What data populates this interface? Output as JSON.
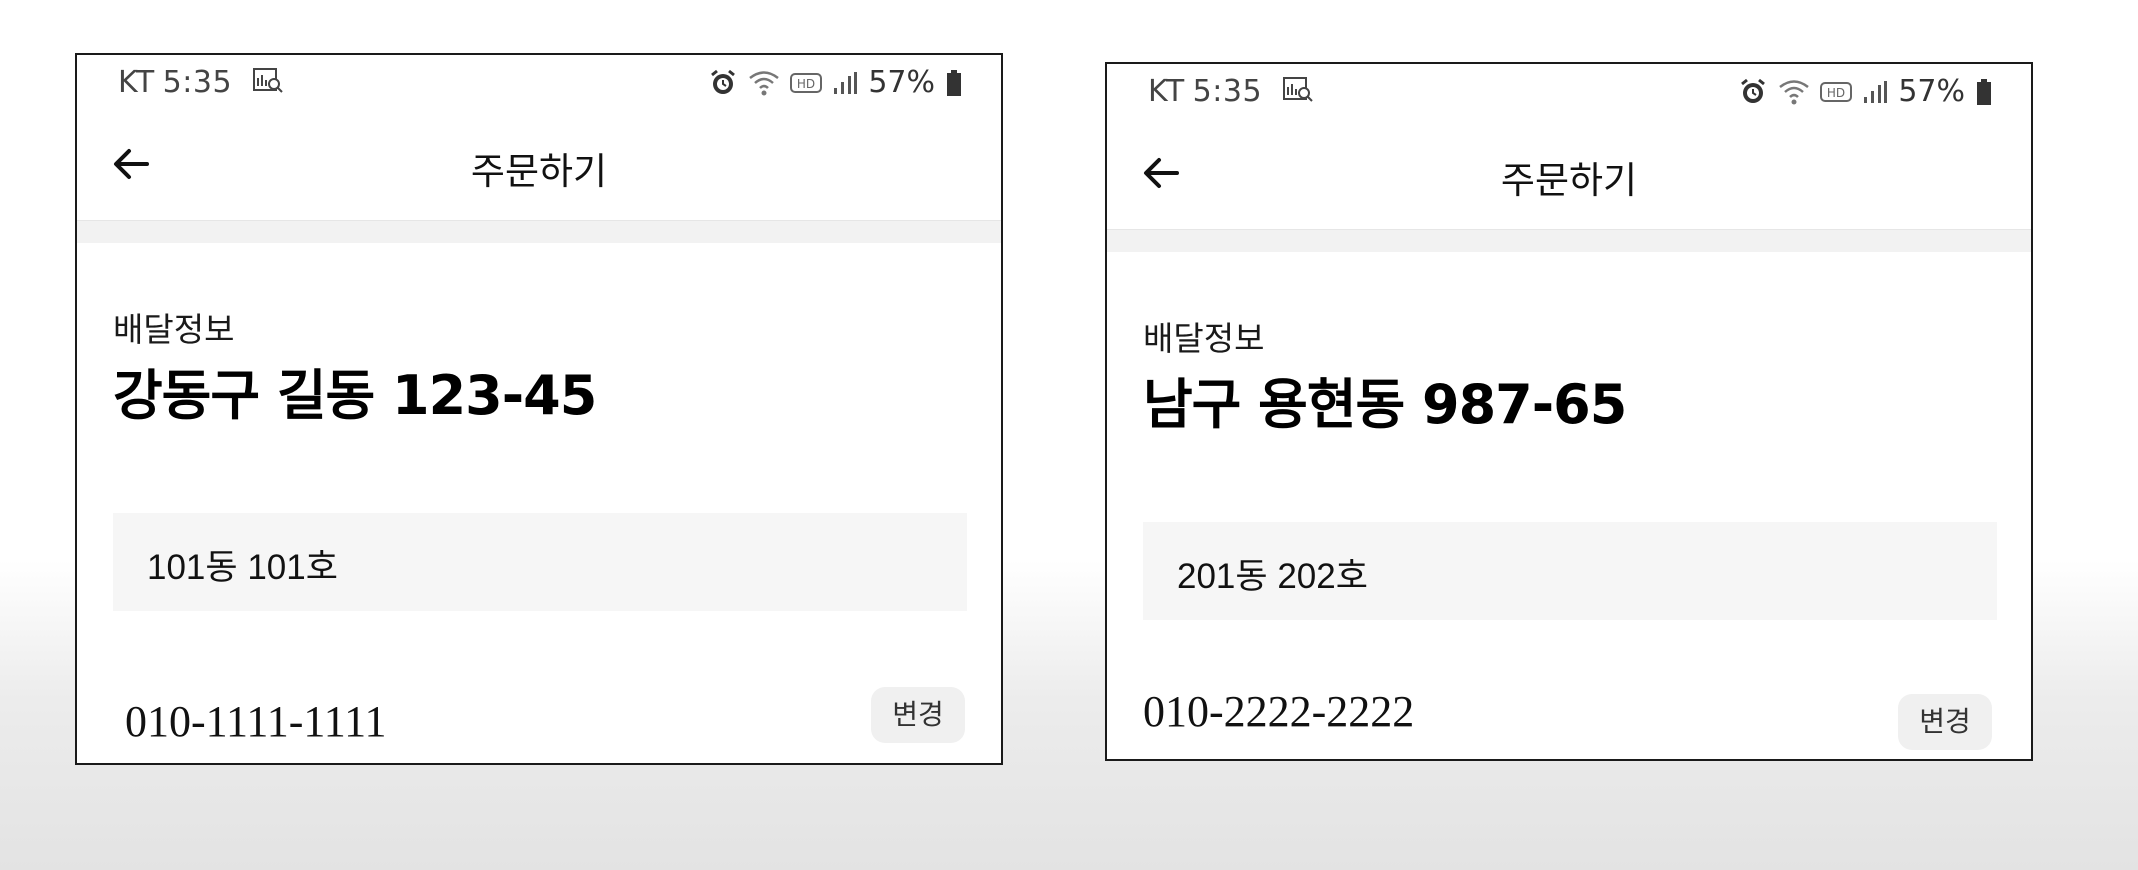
{
  "screens": [
    {
      "status": {
        "carrier": "KT",
        "time": "5:35",
        "battery": "57%"
      },
      "header": {
        "title": "주문하기"
      },
      "delivery": {
        "label": "배달정보",
        "address": "강동구 길동 123-45",
        "detail": "101동 101호",
        "phone": "010-1111-1111",
        "change_label": "변경"
      }
    },
    {
      "status": {
        "carrier": "KT",
        "time": "5:35",
        "battery": "57%"
      },
      "header": {
        "title": "주문하기"
      },
      "delivery": {
        "label": "배달정보",
        "address": "남구 용현동 987-65",
        "detail": "201동 202호",
        "phone": "010-2222-2222",
        "change_label": "변경"
      }
    }
  ]
}
